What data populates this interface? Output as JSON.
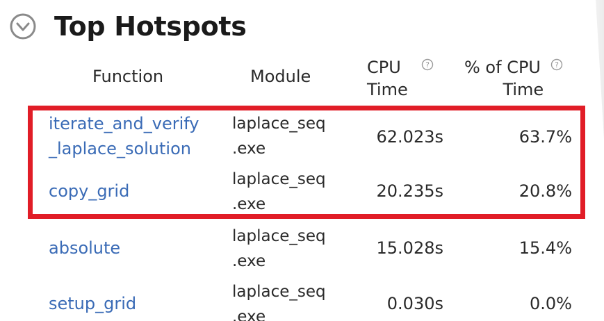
{
  "panel": {
    "title": "Top Hotspots",
    "collapse_icon": "chevron-down-circle-icon"
  },
  "table": {
    "columns": {
      "function": "Function",
      "module": "Module",
      "cpu_time_line1": "CPU",
      "cpu_time_line2": "Time",
      "pct_cpu_line1": "% of CPU",
      "pct_cpu_line2": "Time",
      "help_icon": "help-circle-icon"
    },
    "rows": [
      {
        "function_line1": "iterate_and_verify",
        "function_line2": "_laplace_solution",
        "module_line1": "laplace_seq",
        "module_line2": ".exe",
        "cpu_time": "62.023s",
        "pct_cpu": "63.7%"
      },
      {
        "function_line1": "copy_grid",
        "module_line1": "laplace_seq",
        "module_line2": ".exe",
        "cpu_time": "20.235s",
        "pct_cpu": "20.8%"
      },
      {
        "function_line1": "absolute",
        "module_line1": "laplace_seq",
        "module_line2": ".exe",
        "cpu_time": "15.028s",
        "pct_cpu": "15.4%"
      },
      {
        "function_line1": "setup_grid",
        "module_line1": "laplace_seq",
        "module_line2": ".exe",
        "cpu_time": "0.030s",
        "pct_cpu": "0.0%"
      }
    ]
  },
  "annotation": {
    "highlight_color": "#e11d27"
  },
  "colors": {
    "link": "#3a6bb6",
    "text": "#2a2a2a",
    "icon": "#8a8a8a"
  }
}
